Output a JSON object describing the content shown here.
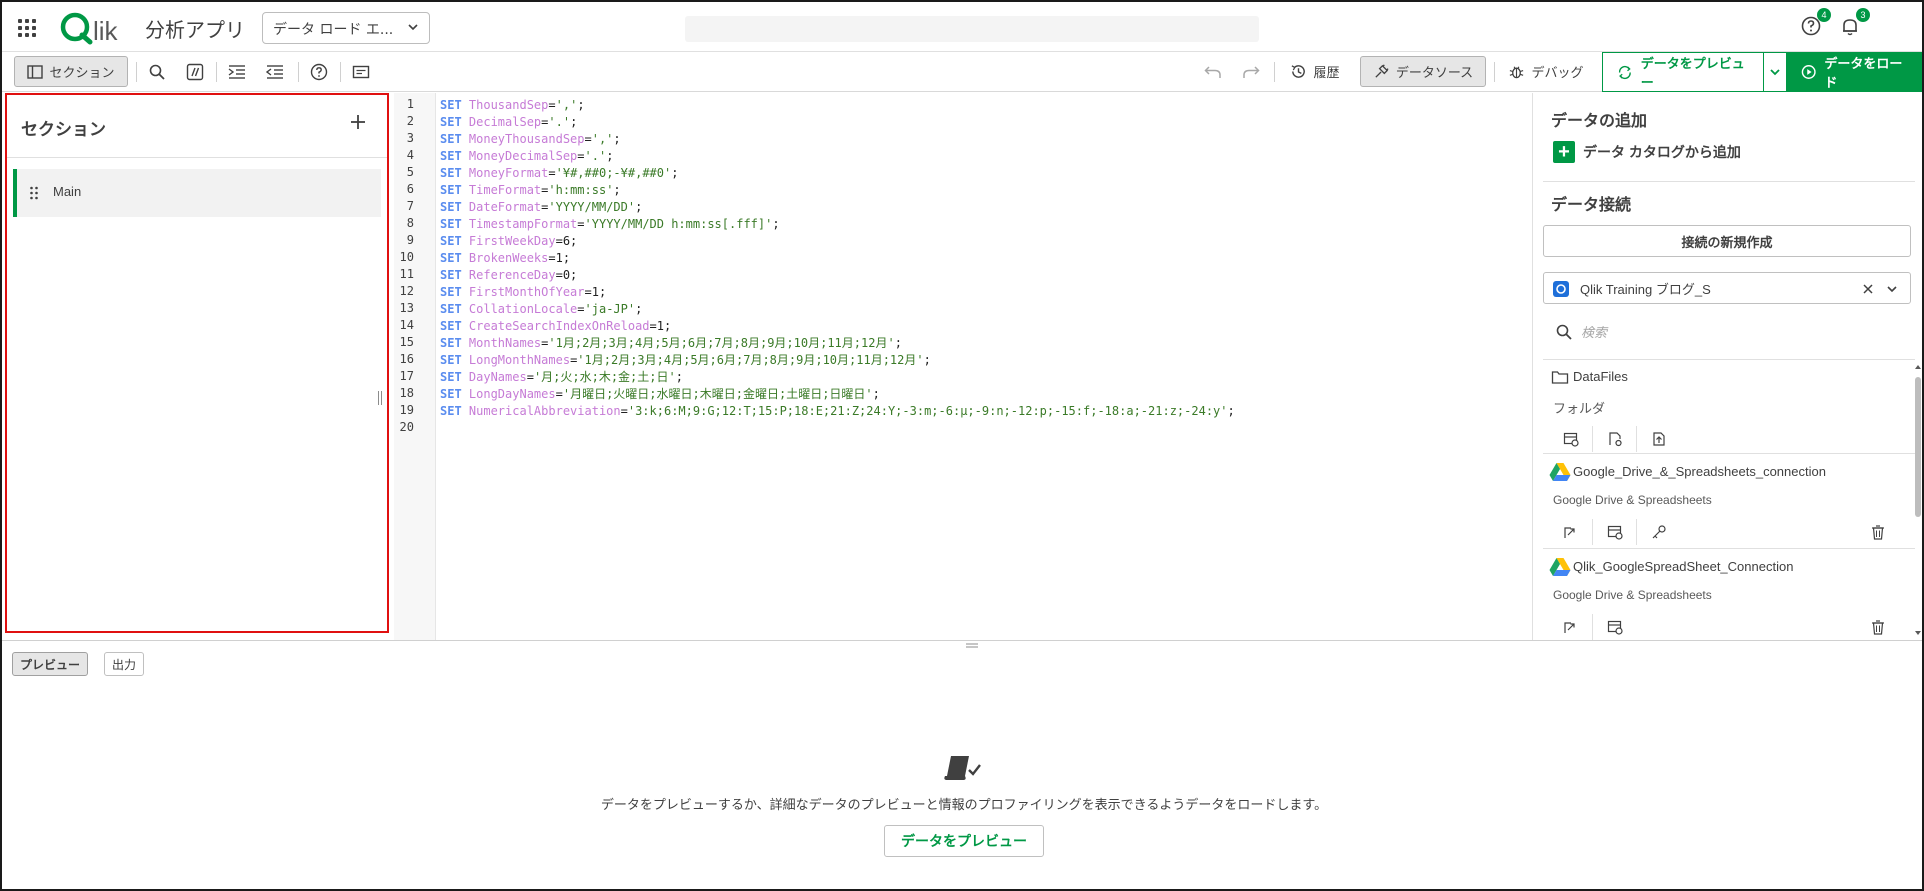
{
  "header": {
    "logo_text": "Qlik",
    "app_name": "分析アプリ",
    "view_select": "データ ロード エ...",
    "help_badge": "4",
    "notifications_badge": "3"
  },
  "toolbar": {
    "sections_label": "セクション",
    "history_label": "履歴",
    "datasource_label": "データソース",
    "debug_label": "デバッグ",
    "preview_data_label": "データをプレビュー",
    "load_data_label": "データをロード"
  },
  "sections": {
    "title": "セクション",
    "items": [
      {
        "label": "Main"
      }
    ]
  },
  "editor": {
    "lines": [
      [
        {
          "t": "kw",
          "v": "SET "
        },
        {
          "t": "var",
          "v": "ThousandSep"
        },
        {
          "t": "op",
          "v": "="
        },
        {
          "t": "str",
          "v": "','"
        },
        {
          "t": "op",
          "v": ";"
        }
      ],
      [
        {
          "t": "kw",
          "v": "SET "
        },
        {
          "t": "var",
          "v": "DecimalSep"
        },
        {
          "t": "op",
          "v": "="
        },
        {
          "t": "str",
          "v": "'.'"
        },
        {
          "t": "op",
          "v": ";"
        }
      ],
      [
        {
          "t": "kw",
          "v": "SET "
        },
        {
          "t": "var",
          "v": "MoneyThousandSep"
        },
        {
          "t": "op",
          "v": "="
        },
        {
          "t": "str",
          "v": "','"
        },
        {
          "t": "op",
          "v": ";"
        }
      ],
      [
        {
          "t": "kw",
          "v": "SET "
        },
        {
          "t": "var",
          "v": "MoneyDecimalSep"
        },
        {
          "t": "op",
          "v": "="
        },
        {
          "t": "str",
          "v": "'.'"
        },
        {
          "t": "op",
          "v": ";"
        }
      ],
      [
        {
          "t": "kw",
          "v": "SET "
        },
        {
          "t": "var",
          "v": "MoneyFormat"
        },
        {
          "t": "op",
          "v": "="
        },
        {
          "t": "str",
          "v": "'¥#,##0;-¥#,##0'"
        },
        {
          "t": "op",
          "v": ";"
        }
      ],
      [
        {
          "t": "kw",
          "v": "SET "
        },
        {
          "t": "var",
          "v": "TimeFormat"
        },
        {
          "t": "op",
          "v": "="
        },
        {
          "t": "str",
          "v": "'h:mm:ss'"
        },
        {
          "t": "op",
          "v": ";"
        }
      ],
      [
        {
          "t": "kw",
          "v": "SET "
        },
        {
          "t": "var",
          "v": "DateFormat"
        },
        {
          "t": "op",
          "v": "="
        },
        {
          "t": "str",
          "v": "'YYYY/MM/DD'"
        },
        {
          "t": "op",
          "v": ";"
        }
      ],
      [
        {
          "t": "kw",
          "v": "SET "
        },
        {
          "t": "var",
          "v": "TimestampFormat"
        },
        {
          "t": "op",
          "v": "="
        },
        {
          "t": "str",
          "v": "'YYYY/MM/DD h:mm:ss[.fff]'"
        },
        {
          "t": "op",
          "v": ";"
        }
      ],
      [
        {
          "t": "kw",
          "v": "SET "
        },
        {
          "t": "var",
          "v": "FirstWeekDay"
        },
        {
          "t": "op",
          "v": "=6;"
        }
      ],
      [
        {
          "t": "kw",
          "v": "SET "
        },
        {
          "t": "var",
          "v": "BrokenWeeks"
        },
        {
          "t": "op",
          "v": "=1;"
        }
      ],
      [
        {
          "t": "kw",
          "v": "SET "
        },
        {
          "t": "var",
          "v": "ReferenceDay"
        },
        {
          "t": "op",
          "v": "=0;"
        }
      ],
      [
        {
          "t": "kw",
          "v": "SET "
        },
        {
          "t": "var",
          "v": "FirstMonthOfYear"
        },
        {
          "t": "op",
          "v": "=1;"
        }
      ],
      [
        {
          "t": "kw",
          "v": "SET "
        },
        {
          "t": "var",
          "v": "CollationLocale"
        },
        {
          "t": "op",
          "v": "="
        },
        {
          "t": "str",
          "v": "'ja-JP'"
        },
        {
          "t": "op",
          "v": ";"
        }
      ],
      [
        {
          "t": "kw",
          "v": "SET "
        },
        {
          "t": "var",
          "v": "CreateSearchIndexOnReload"
        },
        {
          "t": "op",
          "v": "=1;"
        }
      ],
      [
        {
          "t": "kw",
          "v": "SET "
        },
        {
          "t": "var",
          "v": "MonthNames"
        },
        {
          "t": "op",
          "v": "="
        },
        {
          "t": "str",
          "v": "'1月;2月;3月;4月;5月;6月;7月;8月;9月;10月;11月;12月'"
        },
        {
          "t": "op",
          "v": ";"
        }
      ],
      [
        {
          "t": "kw",
          "v": "SET "
        },
        {
          "t": "var",
          "v": "LongMonthNames"
        },
        {
          "t": "op",
          "v": "="
        },
        {
          "t": "str",
          "v": "'1月;2月;3月;4月;5月;6月;7月;8月;9月;10月;11月;12月'"
        },
        {
          "t": "op",
          "v": ";"
        }
      ],
      [
        {
          "t": "kw",
          "v": "SET "
        },
        {
          "t": "var",
          "v": "DayNames"
        },
        {
          "t": "op",
          "v": "="
        },
        {
          "t": "str",
          "v": "'月;火;水;木;金;土;日'"
        },
        {
          "t": "op",
          "v": ";"
        }
      ],
      [
        {
          "t": "kw",
          "v": "SET "
        },
        {
          "t": "var",
          "v": "LongDayNames"
        },
        {
          "t": "op",
          "v": "="
        },
        {
          "t": "str",
          "v": "'月曜日;火曜日;水曜日;木曜日;金曜日;土曜日;日曜日'"
        },
        {
          "t": "op",
          "v": ";"
        }
      ],
      [
        {
          "t": "kw",
          "v": "SET "
        },
        {
          "t": "var",
          "v": "NumericalAbbreviation"
        },
        {
          "t": "op",
          "v": "="
        },
        {
          "t": "str",
          "v": "'3:k;6:M;9:G;12:T;15:P;18:E;21:Z;24:Y;-3:m;-6:μ;-9:n;-12:p;-15:f;-18:a;-21:z;-24:y'"
        },
        {
          "t": "op",
          "v": ";"
        }
      ],
      []
    ]
  },
  "right_panel": {
    "add_data_title": "データの追加",
    "add_from_catalog": "データ カタログから追加",
    "connections_title": "データ接続",
    "new_connection": "接続の新規作成",
    "space_select": "Qlik Training ブログ_S",
    "search_placeholder": "検索",
    "connections": [
      {
        "name": "DataFiles",
        "type": "フォルダ",
        "icon": "folder-icon"
      },
      {
        "name": "Google_Drive_&_Spreadsheets_connection",
        "type": "Google Drive & Spreadsheets",
        "icon": "google-drive-icon"
      },
      {
        "name": "Qlik_GoogleSpreadSheet_Connection",
        "type": "Google Drive & Spreadsheets",
        "icon": "google-drive-icon"
      }
    ]
  },
  "bottom": {
    "tab_preview": "プレビュー",
    "tab_output": "出力",
    "empty_message": "データをプレビューするか、詳細なデータのプレビューと情報のプロファイリングを表示できるようデータをロードします。",
    "preview_button": "データをプレビュー"
  },
  "colors": {
    "accent_green": "#009845",
    "section_border_red": "#e01010",
    "keyword_blue": "#5b8def",
    "variable_purple": "#c67bd6",
    "string_green": "#3a7a27"
  }
}
